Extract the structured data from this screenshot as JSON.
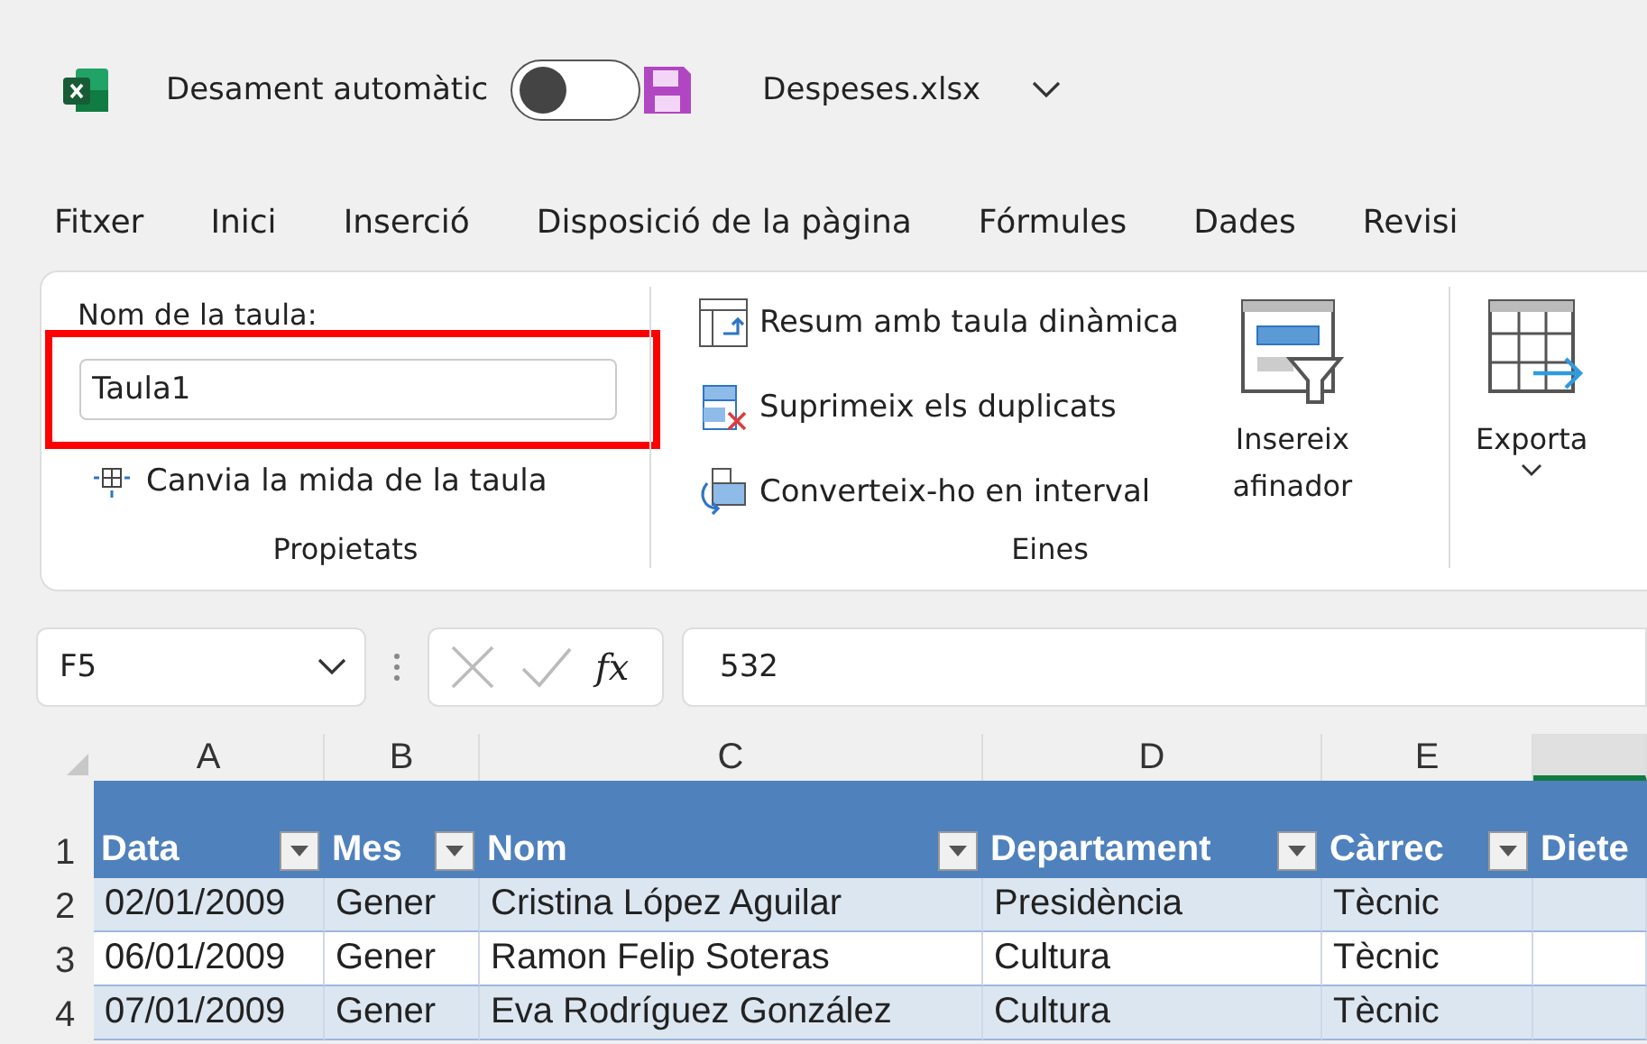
{
  "title_bar": {
    "autosave_label": "Desament automàtic",
    "autosave_on": false,
    "file_name": "Despeses.xlsx"
  },
  "menu_tabs": [
    {
      "label": "Fitxer"
    },
    {
      "label": "Inici"
    },
    {
      "label": "Inserció"
    },
    {
      "label": "Disposició de la pàgina"
    },
    {
      "label": "Fórmules"
    },
    {
      "label": "Dades"
    },
    {
      "label": "Revisi"
    }
  ],
  "ribbon": {
    "properties": {
      "name_label": "Nom de la taula:",
      "name_value": "Taula1",
      "highlighted": true,
      "resize_command": "Canvia la mida de la taula",
      "group_label": "Propietats"
    },
    "tools": {
      "commands": [
        {
          "kind": "pivot",
          "label": "Resum amb taula dinàmica"
        },
        {
          "kind": "duplicates",
          "label": "Suprimeix els duplicats"
        },
        {
          "kind": "convert",
          "label": "Converteix-ho en interval"
        }
      ],
      "slicer_label": "Insereix afinador",
      "group_label": "Eines"
    },
    "export": {
      "label": "Exporta"
    }
  },
  "formula_bar": {
    "name_box": "F5",
    "function_symbol": "fx",
    "formula": "532"
  },
  "grid": {
    "columns": [
      {
        "label": "A",
        "selected": false
      },
      {
        "label": "B",
        "selected": false
      },
      {
        "label": "C",
        "selected": false
      },
      {
        "label": "D",
        "selected": false
      },
      {
        "label": "E",
        "selected": false
      },
      {
        "selected": true
      }
    ],
    "table_header": {
      "row_number": "1",
      "cells": [
        {
          "label": "Data",
          "filter": true
        },
        {
          "label": "Mes",
          "filter": true
        },
        {
          "label": "Nom",
          "filter": true
        },
        {
          "label": "Departament",
          "filter": true
        },
        {
          "label": "Càrrec",
          "filter": true
        },
        {
          "label": "Diete"
        }
      ]
    },
    "rows": [
      {
        "row_number": "2",
        "banded": true,
        "cells": [
          "02/01/2009",
          "Gener",
          "Cristina López Aguilar",
          "Presidència",
          "Tècnic"
        ]
      },
      {
        "row_number": "3",
        "banded": false,
        "cells": [
          "06/01/2009",
          "Gener",
          "Ramon Felip Soteras",
          "Cultura",
          "Tècnic"
        ]
      },
      {
        "row_number": "4",
        "banded": true,
        "cells": [
          "07/01/2009",
          "Gener",
          "Eva Rodríguez González",
          "Cultura",
          "Tècnic"
        ]
      }
    ]
  }
}
